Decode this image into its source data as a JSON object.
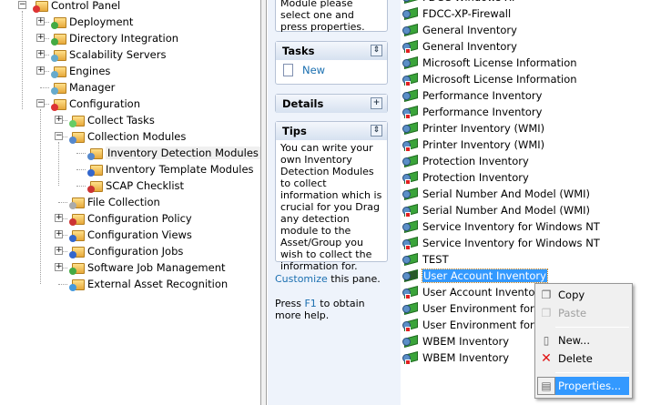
{
  "tree": [
    {
      "label": "Control Panel",
      "level": 0,
      "expander": "minus"
    },
    {
      "label": "Deployment",
      "level": 1,
      "expander": "plus"
    },
    {
      "label": "Directory Integration",
      "level": 1,
      "expander": "plus"
    },
    {
      "label": "Scalability Servers",
      "level": 1,
      "expander": "plus"
    },
    {
      "label": "Engines",
      "level": 1,
      "expander": "plus"
    },
    {
      "label": "Manager",
      "level": 1,
      "expander": ""
    },
    {
      "label": "Configuration",
      "level": 1,
      "expander": "minus"
    },
    {
      "label": "Collect Tasks",
      "level": 2,
      "expander": "plus"
    },
    {
      "label": "Collection Modules",
      "level": 2,
      "expander": "minus"
    },
    {
      "label": "Inventory Detection Modules",
      "level": 3,
      "expander": "",
      "selected": true
    },
    {
      "label": "Inventory Template Modules",
      "level": 3,
      "expander": ""
    },
    {
      "label": "SCAP Checklist",
      "level": 3,
      "expander": ""
    },
    {
      "label": "File Collection",
      "level": 2,
      "expander": ""
    },
    {
      "label": "Configuration Policy",
      "level": 2,
      "expander": "plus"
    },
    {
      "label": "Configuration Views",
      "level": 2,
      "expander": "plus"
    },
    {
      "label": "Configuration Jobs",
      "level": 2,
      "expander": "plus"
    },
    {
      "label": "Software Job Management",
      "level": 2,
      "expander": "plus"
    },
    {
      "label": "External Asset Recognition",
      "level": 2,
      "expander": ""
    }
  ],
  "taskpane": {
    "intro_text": "Module please select one and press properties.",
    "tasks_title": "Tasks",
    "new_label": "New",
    "details_title": "Details",
    "tips_title": "Tips",
    "tips_text": "You can write your own Inventory Detection Modules to collect information which is crucial for you Drag any detection module to the Asset/Group you wish to collect the information for.",
    "customize_link": "Customize",
    "customize_rest": " this pane.",
    "help_pre": "Press ",
    "help_key": "F1",
    "help_post": " to obtain more help."
  },
  "list": [
    {
      "label": "FDCC-Windows-XP",
      "red": false
    },
    {
      "label": "FDCC-XP-Firewall",
      "red": false
    },
    {
      "label": "General Inventory",
      "red": false
    },
    {
      "label": "General Inventory",
      "red": true
    },
    {
      "label": "Microsoft License Information",
      "red": false
    },
    {
      "label": "Microsoft License Information",
      "red": true
    },
    {
      "label": "Performance Inventory",
      "red": false
    },
    {
      "label": "Performance Inventory",
      "red": true
    },
    {
      "label": "Printer Inventory (WMI)",
      "red": false
    },
    {
      "label": "Printer Inventory (WMI)",
      "red": true
    },
    {
      "label": "Protection Inventory",
      "red": false
    },
    {
      "label": "Protection Inventory",
      "red": true
    },
    {
      "label": "Serial Number And Model (WMI)",
      "red": false
    },
    {
      "label": "Serial Number And Model (WMI)",
      "red": true
    },
    {
      "label": "Service Inventory for Windows NT",
      "red": false
    },
    {
      "label": "Service Inventory for Windows NT",
      "red": true
    },
    {
      "label": "TEST",
      "red": false
    },
    {
      "label": "User Account Inventory",
      "red": false,
      "selected": true
    },
    {
      "label": "User Account Inventory",
      "red": true
    },
    {
      "label": "User Environment for U",
      "red": false
    },
    {
      "label": "User Environment for U",
      "red": true
    },
    {
      "label": "WBEM Inventory",
      "red": false
    },
    {
      "label": "WBEM Inventory",
      "red": true
    }
  ],
  "context_menu": {
    "copy": "Copy",
    "paste": "Paste",
    "new": "New...",
    "delete": "Delete",
    "properties": "Properties..."
  }
}
